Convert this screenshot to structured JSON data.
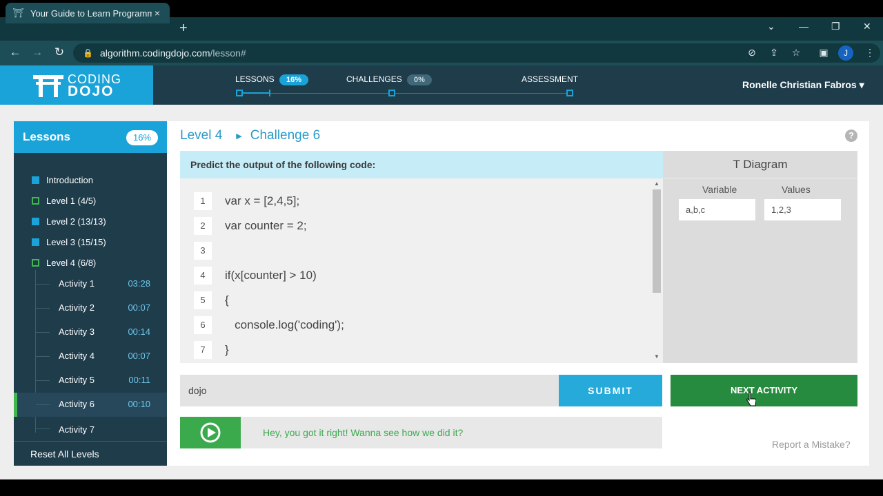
{
  "browser": {
    "tab_title": "Your Guide to Learn Programmin",
    "tab_close": "×",
    "new_tab": "+",
    "url_host": "algorithm.codingdojo.com",
    "url_path": "/lesson#",
    "profile_initial": "J"
  },
  "header": {
    "logo_line1": "CODING",
    "logo_line2": "DOJO",
    "nav": [
      {
        "label": "LESSONS",
        "pct": "16%"
      },
      {
        "label": "CHALLENGES",
        "pct": "0%"
      },
      {
        "label": "ASSESSMENT"
      }
    ],
    "user_name": "Ronelle Christian Fabros ▾"
  },
  "sidebar": {
    "title": "Lessons",
    "percent": "16%",
    "levels": [
      {
        "label": "Introduction",
        "state": "done"
      },
      {
        "label": "Level 1 (4/5)",
        "state": "open"
      },
      {
        "label": "Level 2 (13/13)",
        "state": "done"
      },
      {
        "label": "Level 3 (15/15)",
        "state": "done"
      },
      {
        "label": "Level 4 (6/8)",
        "state": "open"
      }
    ],
    "activities": [
      {
        "name": "Activity 1",
        "time": "03:28"
      },
      {
        "name": "Activity 2",
        "time": "00:07"
      },
      {
        "name": "Activity 3",
        "time": "00:14"
      },
      {
        "name": "Activity 4",
        "time": "00:07"
      },
      {
        "name": "Activity 5",
        "time": "00:11"
      },
      {
        "name": "Activity 6",
        "time": "00:10"
      },
      {
        "name": "Activity 7",
        "time": ""
      }
    ],
    "active_activity": "Activity 6",
    "reset_label": "Reset All Levels"
  },
  "main": {
    "level": "Level 4",
    "challenge": "Challenge 6",
    "help": "?",
    "prompt": "Predict the output of the following code:",
    "code_lines": [
      {
        "n": "1",
        "text": "var x = [2,4,5];"
      },
      {
        "n": "2",
        "text": "var counter = 2;"
      },
      {
        "n": "3",
        "text": ""
      },
      {
        "n": "4",
        "text": "if(x[counter] > 10)"
      },
      {
        "n": "5",
        "text": "{"
      },
      {
        "n": "6",
        "text": "   console.log('coding');"
      },
      {
        "n": "7",
        "text": "}"
      }
    ],
    "t_diagram": {
      "title": "T Diagram",
      "col_variable": "Variable",
      "col_values": "Values",
      "variable_value": "a,b,c",
      "values_value": "1,2,3"
    },
    "answer_value": "dojo",
    "submit_label": "SUBMIT",
    "next_label": "NEXT ACTIVITY",
    "feedback": "Hey, you got it right! Wanna see how we did it?",
    "report": "Report a Mistake?"
  },
  "colors": {
    "brand_blue": "#1aa3d8",
    "header_dark": "#1f3c4b",
    "success_green": "#3aaa4c",
    "next_green": "#268b3e"
  }
}
